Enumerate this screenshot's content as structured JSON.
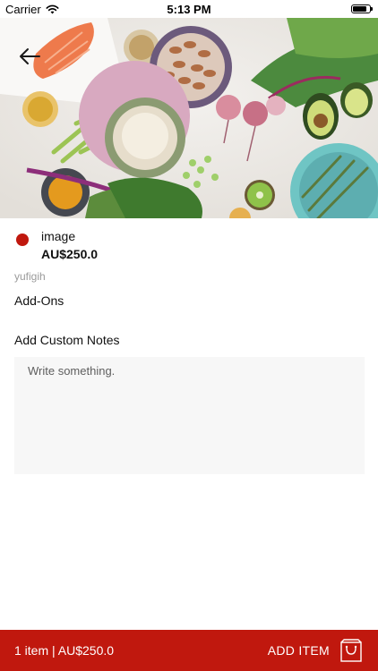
{
  "status_bar": {
    "carrier": "Carrier",
    "time": "5:13 PM",
    "battery_level": 0.85
  },
  "hero": {
    "back_icon": "arrow-left-icon",
    "image_subject": "food-ingredients-photo"
  },
  "product": {
    "name": "image",
    "price": "AU$250.0",
    "description": "yufigih",
    "indicator_color": "#c0180e"
  },
  "sections": {
    "addons_label": "Add-Ons",
    "notes_label": "Add Custom Notes",
    "notes_placeholder": "Write something.",
    "notes_value": ""
  },
  "bottom_bar": {
    "summary": "1 item | AU$250.0",
    "add_item_label": "ADD ITEM",
    "bag_icon": "shopping-bag-icon",
    "background_color": "#c0180e"
  }
}
